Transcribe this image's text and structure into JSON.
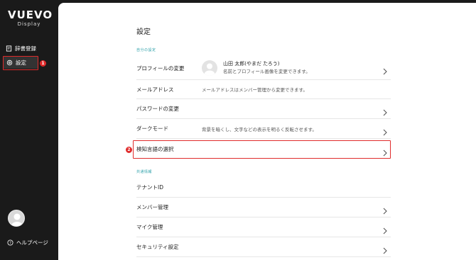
{
  "sidebar": {
    "logo": {
      "main": "VUEVO",
      "sub": "Display"
    },
    "items": [
      {
        "label": "辞書登録",
        "icon": "dictionary-icon"
      },
      {
        "label": "設定",
        "icon": "settings-icon"
      }
    ],
    "help_label": "ヘルプページ"
  },
  "annotations": {
    "badge1": "1",
    "badge2": "2",
    "color": "#e02b2b"
  },
  "main": {
    "title": "設定",
    "sections": [
      {
        "label": "自分の設定"
      },
      {
        "label": "共通情報"
      }
    ],
    "profile": {
      "label": "プロフィールの変更",
      "name": "山田 太郎(やまだ たろう)",
      "desc": "名前とプロフィール画像を変更できます。"
    },
    "email": {
      "label": "メールアドレス",
      "desc": "メールアドレスはメンバー管理から変更できます。"
    },
    "password": {
      "label": "パスワードの変更"
    },
    "dark": {
      "label": "ダークモード",
      "desc": "背景を暗くし、文字などの表示を明るく反転させます。"
    },
    "language": {
      "label": "検知言語の選択"
    },
    "tenant": {
      "label": "テナントID"
    },
    "members": {
      "label": "メンバー管理"
    },
    "mic": {
      "label": "マイク管理"
    },
    "security": {
      "label": "セキュリティ設定"
    }
  },
  "colors": {
    "accent": "#2a9fa8",
    "sidebar_bg": "#1a1a1a",
    "highlight": "#e02b2b"
  }
}
